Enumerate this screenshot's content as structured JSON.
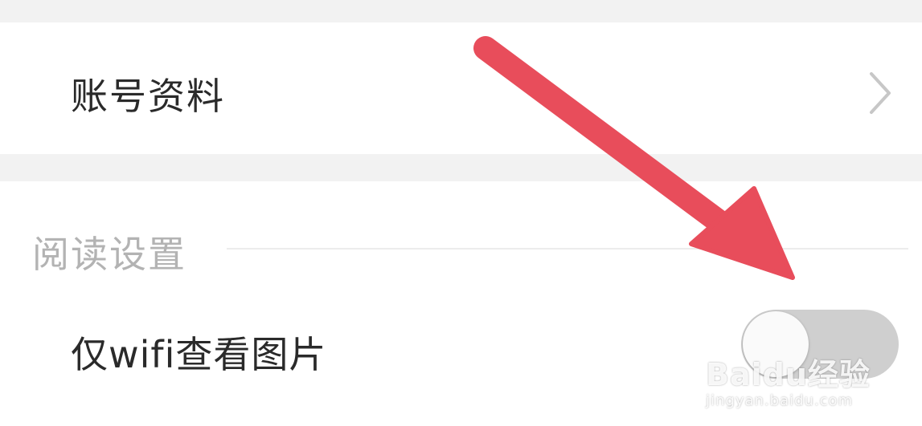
{
  "account_row": {
    "label": "账号资料",
    "chevron_icon": "chevron-right-icon"
  },
  "reading_section": {
    "header": "阅读设置",
    "wifi_images": {
      "label": "仅wifi查看图片",
      "toggle_on": false
    }
  },
  "annotation": {
    "arrow_color": "#e84d5b",
    "arrow_icon": "arrow-icon"
  },
  "watermark": {
    "brand": "Baidu经验",
    "url": "jingyan.baidu.com"
  },
  "colors": {
    "background": "#f2f2f2",
    "card": "#ffffff",
    "toggle_off": "#cfcfcf"
  }
}
